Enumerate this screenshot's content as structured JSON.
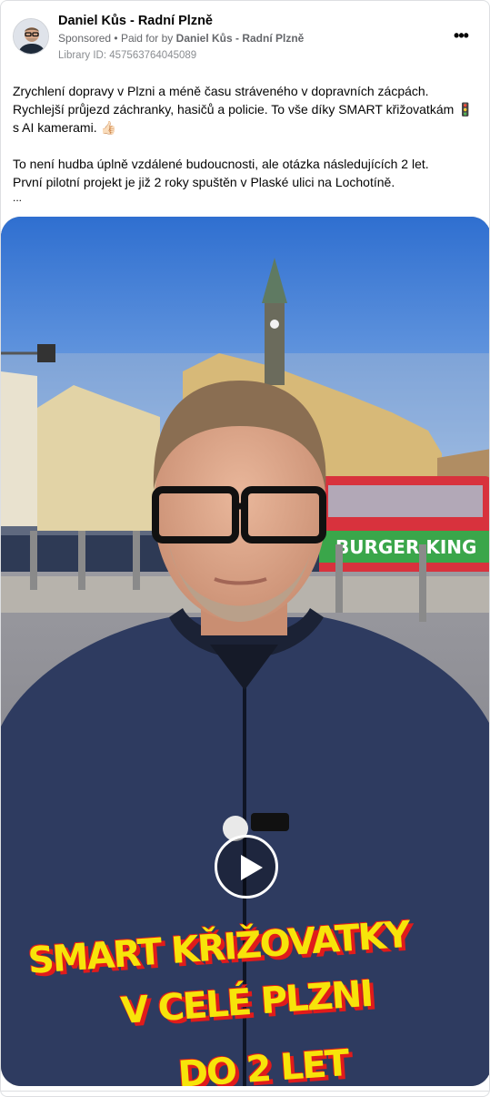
{
  "ad": {
    "page_name": "Daniel Kůs - Radní Plzně",
    "sponsored": "Sponsored",
    "paid_for_prefix": "Paid for by",
    "paid_for_name": "Daniel Kůs - Radní Plzně",
    "library_id": "Library ID: 457563764045089",
    "more_icon": "more-horizontal-icon"
  },
  "post": {
    "paragraph1": "Zrychlení dopravy v Plzni a méně času stráveného v dopravních zácpách. Rychlejší průjezd záchranky, hasičů a policie. To vše díky SMART křižovatkám 🚦 s AI kamerami. 👍🏻",
    "paragraph2_line1": "To není hudba úplně vzdálené budoucnosti, ale otázka následujících 2 let.",
    "paragraph2_line2": "První pilotní projekt je již 2 roky spuštěn v Plaské ulici na Lochotíně.",
    "ellipsis": "..."
  },
  "video": {
    "play_icon": "play-icon",
    "overlay_line1": "SMART KŘIŽOVATKY",
    "overlay_line2": "V CELÉ PLZNI",
    "overlay_line3": "DO 2 LET",
    "overlay_text_color": "#f7e40a",
    "overlay_shadow_color": "#e01b1b",
    "tram_sign": "BURGER KING"
  }
}
